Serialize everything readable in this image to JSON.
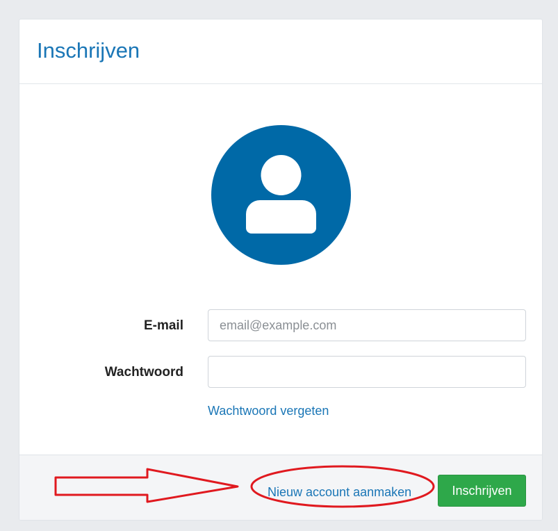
{
  "header": {
    "title": "Inschrijven"
  },
  "avatar": {
    "icon": "user-icon",
    "bg_color": "#0069a7"
  },
  "form": {
    "email_label": "E-mail",
    "email_placeholder": "email@example.com",
    "email_value": "",
    "password_label": "Wachtwoord",
    "password_value": "",
    "forgot_link": "Wachtwoord vergeten"
  },
  "footer": {
    "new_account_label": "Nieuw account aanmaken",
    "submit_label": "Inschrijven"
  },
  "colors": {
    "accent": "#1a76b6",
    "submit_bg": "#2ea84a",
    "annotation": "#e0191f"
  }
}
